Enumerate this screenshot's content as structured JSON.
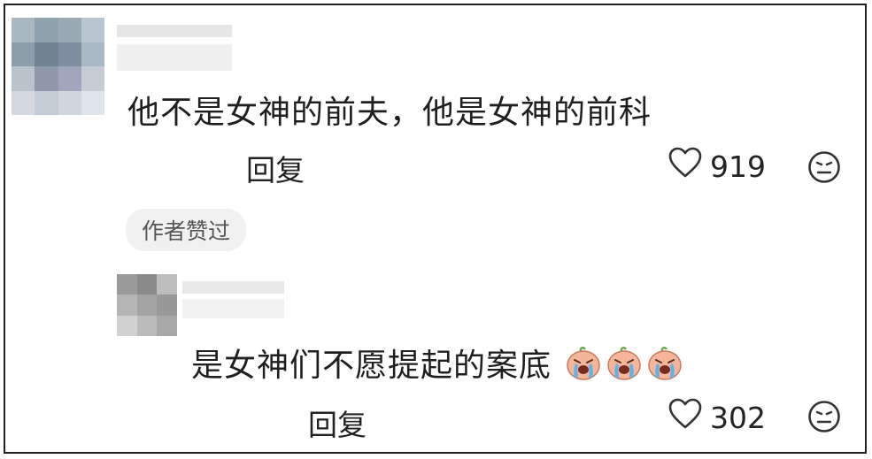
{
  "comments": [
    {
      "text": "他不是女神的前夫，他是女神的前科",
      "reply_label": "回复",
      "likes": "919",
      "author_liked_tag": "作者赞过"
    },
    {
      "text": "是女神们不愿提起的案底",
      "reply_label": "回复",
      "likes": "302",
      "emoji_count": 3
    }
  ],
  "colors": {
    "border": "#222222",
    "tag_bg": "#f1f1f1",
    "tag_text": "#555555",
    "emoji_skin": "#f5b59a",
    "emoji_tear": "#5fb3e6"
  },
  "icons": [
    "heart-outline-icon",
    "dislike-face-icon",
    "crying-emoji-icon"
  ]
}
